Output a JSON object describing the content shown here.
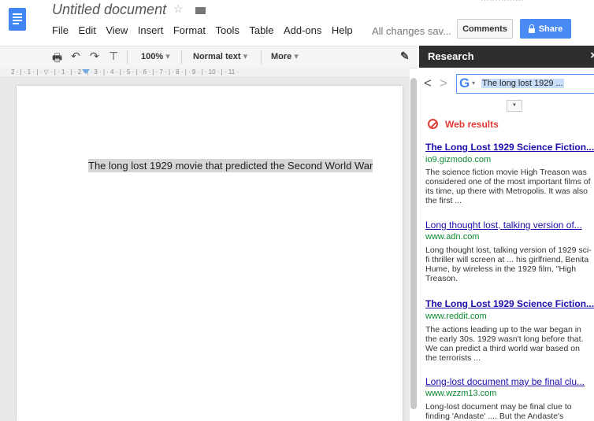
{
  "header": {
    "doc_title": "Untitled document",
    "menu": [
      "File",
      "Edit",
      "View",
      "Insert",
      "Format",
      "Tools",
      "Table",
      "Add-ons",
      "Help"
    ],
    "save_status": "All changes sav...",
    "comments_label": "Comments",
    "share_label": "Share"
  },
  "toolbar": {
    "zoom": "100%",
    "style": "Normal text",
    "more": "More"
  },
  "document": {
    "text": "The long lost 1929 movie that predicted the Second World War"
  },
  "research": {
    "title": "Research",
    "close": "×",
    "query": "The long lost 1929 ...",
    "section_label": "Web results",
    "results": [
      {
        "title": "The Long Lost 1929 Science Fiction...",
        "url": "io9.gizmodo.com",
        "snippet": "The science fiction movie High Treason was considered one of the most important films of its time, up there with Metropolis. It was also the first ..."
      },
      {
        "title": "Long thought lost, talking version of...",
        "url": "www.adn.com",
        "snippet": "Long thought lost, talking version of 1929 sci-fi thriller will screen at ... his girlfriend, Benita Hume, by wireless in the 1929 film, \"High Treason."
      },
      {
        "title": "The Long Lost 1929 Science Fiction...",
        "url": "www.reddit.com",
        "snippet": "The actions leading up to the war began in the early 30s. 1929 wasn't long before that. We can predict a third world war based on the terrorists ..."
      },
      {
        "title": "Long-lost document may be final clu...",
        "url": "www.wzzm13.com",
        "snippet": "Long-lost document may be final clue to finding 'Andaste' .... But the Andaste's"
      }
    ]
  }
}
